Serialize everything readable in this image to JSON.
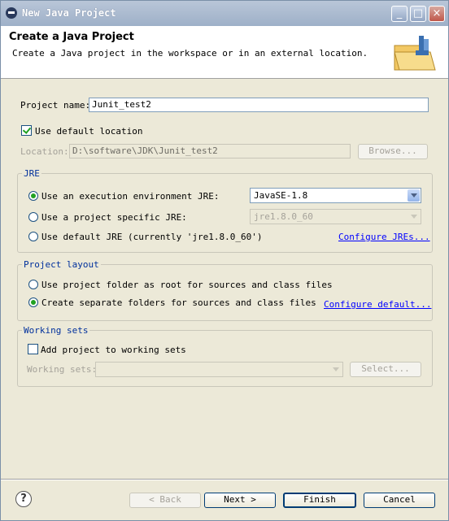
{
  "window": {
    "title": "New Java Project"
  },
  "header": {
    "title": "Create a Java Project",
    "description": "Create a Java project in the workspace or in an external location."
  },
  "project_name": {
    "label": "Project name:",
    "value": "Junit_test2"
  },
  "use_default_location": {
    "label": "Use default location",
    "checked": true
  },
  "location": {
    "label": "Location:",
    "value": "D:\\software\\JDK\\Junit_test2",
    "browse_label": "Browse..."
  },
  "jre": {
    "title": "JRE",
    "option_execution_env": "Use an execution environment JRE:",
    "execution_env_value": "JavaSE-1.8",
    "option_project_specific": "Use a project specific JRE:",
    "project_specific_value": "jre1.8.0_60",
    "option_default": "Use default JRE (currently 'jre1.8.0_60')",
    "configure_link": "Configure JREs..."
  },
  "project_layout": {
    "title": "Project layout",
    "option_root": "Use project folder as root for sources and class files",
    "option_separate": "Create separate folders for sources and class files",
    "configure_link": "Configure default..."
  },
  "working_sets": {
    "title": "Working sets",
    "add_label": "Add project to working sets",
    "sets_label": "Working sets:",
    "select_label": "Select..."
  },
  "footer": {
    "help": "?",
    "back": "< Back",
    "next": "Next >",
    "finish": "Finish",
    "cancel": "Cancel"
  }
}
